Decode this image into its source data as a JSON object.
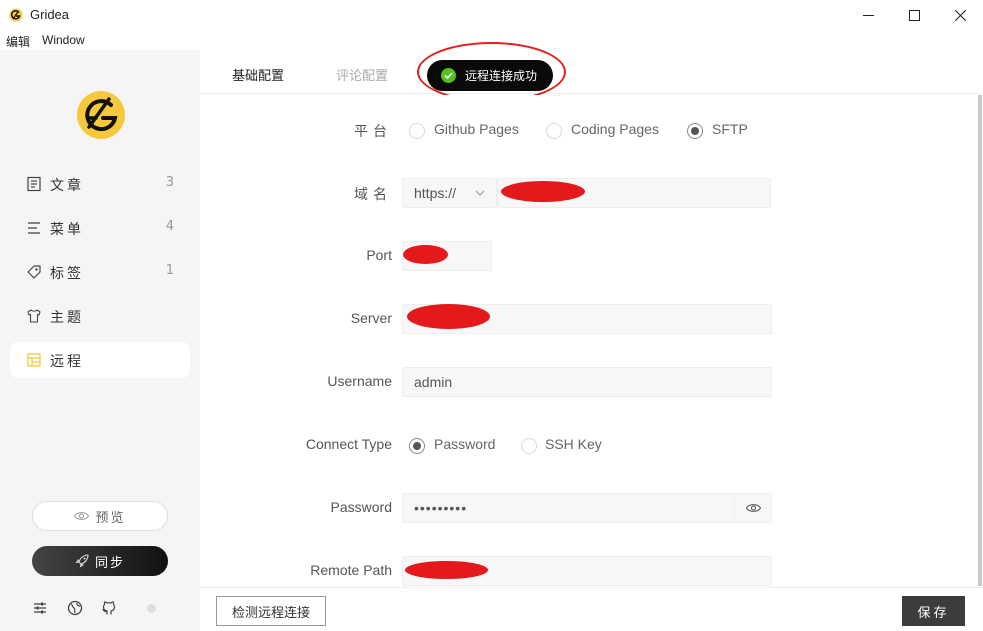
{
  "window": {
    "title": "Gridea"
  },
  "menu": {
    "items": [
      "编辑",
      "Window"
    ]
  },
  "sidebar": {
    "items": [
      {
        "label": "文章",
        "count": "3",
        "icon": "article-icon"
      },
      {
        "label": "菜单",
        "count": "4",
        "icon": "menu-icon"
      },
      {
        "label": "标签",
        "count": "1",
        "icon": "tag-icon"
      },
      {
        "label": "主题",
        "count": "",
        "icon": "theme-icon"
      },
      {
        "label": "远程",
        "count": "",
        "icon": "remote-icon",
        "active": true
      }
    ],
    "preview_label": "预览",
    "sync_label": "同步"
  },
  "tabs": [
    {
      "label": "基础配置",
      "active": true
    },
    {
      "label": "评论配置",
      "active": false
    }
  ],
  "toast": {
    "message": "远程连接成功",
    "color": "#52c41a"
  },
  "form": {
    "platform": {
      "label": "平台",
      "options": [
        "Github Pages",
        "Coding Pages",
        "SFTP"
      ],
      "selected": "SFTP"
    },
    "domain": {
      "label": "域名",
      "protocol": "https://"
    },
    "port": {
      "label": "Port"
    },
    "server": {
      "label": "Server"
    },
    "username": {
      "label": "Username",
      "value": "admin"
    },
    "connect_type": {
      "label": "Connect Type",
      "options": [
        "Password",
        "SSH Key"
      ],
      "selected": "Password"
    },
    "password": {
      "label": "Password",
      "value": "•••••••••"
    },
    "remote_path": {
      "label": "Remote Path"
    }
  },
  "actions": {
    "check_label": "检测远程连接",
    "save_label": "保存"
  },
  "colors": {
    "accent_yellow": "#f6c93c",
    "redaction": "#e3191c",
    "dark": "#111111"
  }
}
